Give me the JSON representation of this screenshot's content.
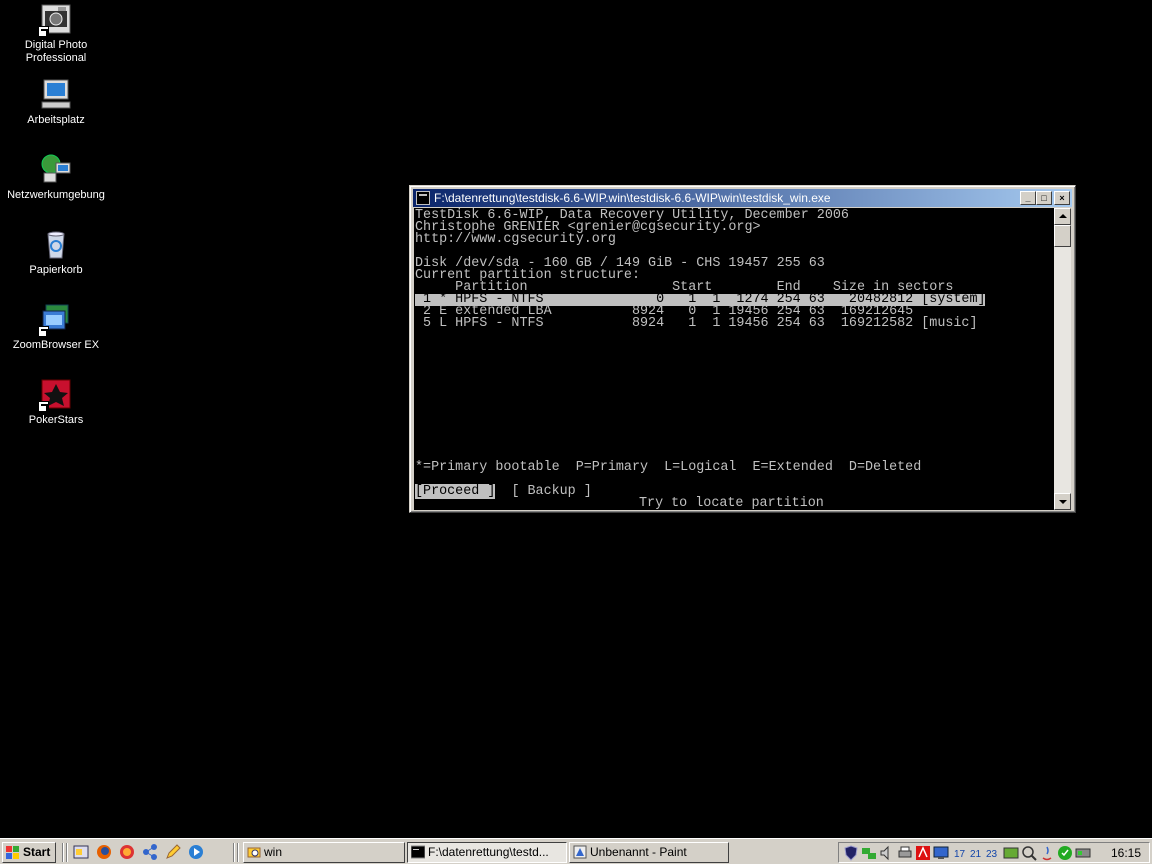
{
  "desktop": {
    "icons": [
      {
        "label": "Digital Photo Professional",
        "icon": "camera-icon"
      },
      {
        "label": "Arbeitsplatz",
        "icon": "computer-icon"
      },
      {
        "label": "Netzwerkumgebung",
        "icon": "network-icon"
      },
      {
        "label": "Papierkorb",
        "icon": "recycle-bin-icon"
      },
      {
        "label": "ZoomBrowser EX",
        "icon": "zoombrowser-icon"
      },
      {
        "label": "PokerStars",
        "icon": "pokerstars-icon"
      }
    ]
  },
  "window": {
    "title": "F:\\datenrettung\\testdisk-6.6-WIP.win\\testdisk-6.6-WIP\\win\\testdisk_win.exe",
    "minimize": "_",
    "maximize": "□",
    "close": "×"
  },
  "console": {
    "line1": "TestDisk 6.6-WIP, Data Recovery Utility, December 2006",
    "line2": "Christophe GRENIER <grenier@cgsecurity.org>",
    "line3": "http://www.cgsecurity.org",
    "disk": "Disk /dev/sda - 160 GB / 149 GiB - CHS 19457 255 63",
    "structure": "Current partition structure:",
    "header": "     Partition                  Start        End    Size in sectors",
    "rows": [
      " 1 * HPFS - NTFS              0   1  1  1274 254 63   20482812 [system]",
      " 2 E extended LBA          8924   0  1 19456 254 63  169212645",
      " 5 L HPFS - NTFS           8924   1  1 19456 254 63  169212582 [music]"
    ],
    "legend": "*=Primary bootable  P=Primary  L=Logical  E=Extended  D=Deleted",
    "proceed": "[Proceed ]",
    "backup": "[ Backup ]",
    "hint": "Try to locate partition"
  },
  "taskbar": {
    "start": "Start",
    "tasks": [
      {
        "label": "win",
        "icon": "folder-search-icon"
      },
      {
        "label": "F:\\datenrettung\\testd...",
        "icon": "console-icon",
        "active": true
      },
      {
        "label": "Unbenannt - Paint",
        "icon": "paint-icon"
      }
    ],
    "clock": "16:15"
  }
}
